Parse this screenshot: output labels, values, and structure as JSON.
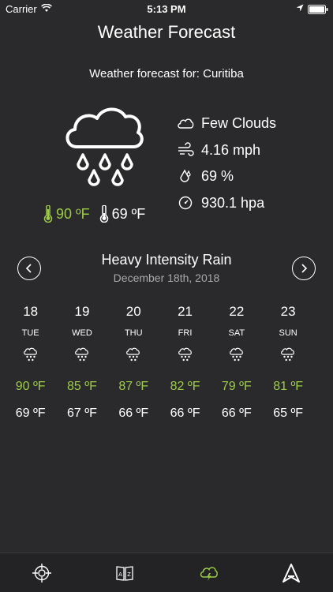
{
  "status_bar": {
    "carrier": "Carrier",
    "time": "5:13 PM"
  },
  "nav": {
    "title": "Weather Forecast"
  },
  "current": {
    "location_line": "Weather forecast for: Curitiba",
    "high": "90 ºF",
    "low": "69 ºF",
    "condition": "Few Clouds",
    "wind": "4.16 mph",
    "humidity": "69 %",
    "pressure": "930.1 hpa"
  },
  "selected": {
    "description": "Heavy Intensity Rain",
    "date": "December 18th, 2018"
  },
  "days": [
    {
      "num": "18",
      "name": "TUE",
      "high": "90 ºF",
      "low": "69 ºF"
    },
    {
      "num": "19",
      "name": "WED",
      "high": "85 ºF",
      "low": "67 ºF"
    },
    {
      "num": "20",
      "name": "THU",
      "high": "87 ºF",
      "low": "66 ºF"
    },
    {
      "num": "21",
      "name": "FRI",
      "high": "82 ºF",
      "low": "66 ºF"
    },
    {
      "num": "22",
      "name": "SAT",
      "high": "79 ºF",
      "low": "66 ºF"
    },
    {
      "num": "23",
      "name": "SUN",
      "high": "81 ºF",
      "low": "65 ºF"
    }
  ],
  "tabs": [
    {
      "icon": "crosshair-icon"
    },
    {
      "icon": "dictionary-icon"
    },
    {
      "icon": "weather-icon",
      "active": true
    },
    {
      "icon": "navigation-icon"
    }
  ],
  "colors": {
    "background": "#2a2a2c",
    "accent": "#9ccb47",
    "muted": "#a9a9ad"
  }
}
